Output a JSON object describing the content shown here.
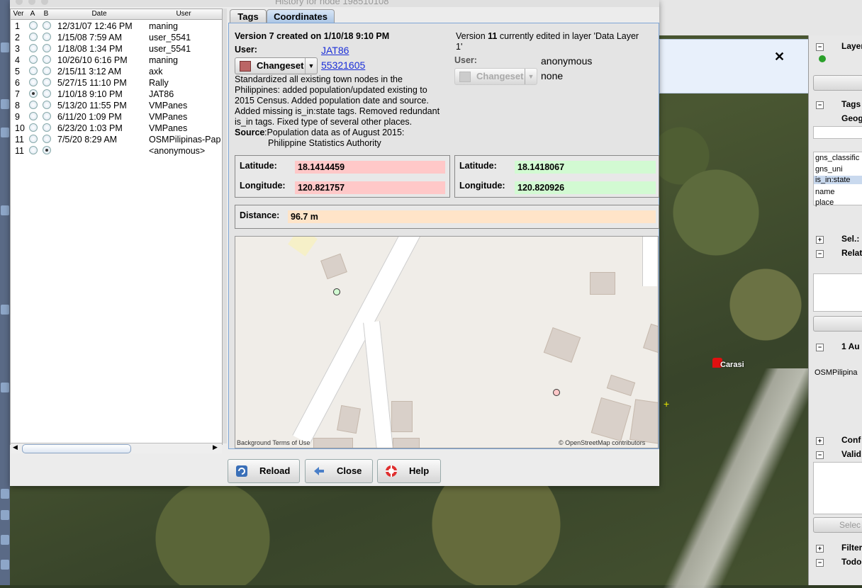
{
  "dialog": {
    "title": "History for node 198510108"
  },
  "versions_table": {
    "columns": [
      "Ver",
      "A",
      "B",
      "Date",
      "User"
    ],
    "rows": [
      {
        "ver": "1",
        "a": false,
        "b": false,
        "date": "12/31/07 12:46 PM",
        "user": "maning"
      },
      {
        "ver": "2",
        "a": false,
        "b": false,
        "date": "1/15/08 7:59 AM",
        "user": "user_5541"
      },
      {
        "ver": "3",
        "a": false,
        "b": false,
        "date": "1/18/08 1:34 PM",
        "user": "user_5541"
      },
      {
        "ver": "4",
        "a": false,
        "b": false,
        "date": "10/26/10 6:16 PM",
        "user": "maning"
      },
      {
        "ver": "5",
        "a": false,
        "b": false,
        "date": "2/15/11 3:12 AM",
        "user": "axk"
      },
      {
        "ver": "6",
        "a": false,
        "b": false,
        "date": "5/27/15 11:10 PM",
        "user": "Rally"
      },
      {
        "ver": "7",
        "a": true,
        "b": false,
        "date": "1/10/18 9:10 PM",
        "user": "JAT86"
      },
      {
        "ver": "8",
        "a": false,
        "b": false,
        "date": "5/13/20 11:55 PM",
        "user": "VMPanes"
      },
      {
        "ver": "9",
        "a": false,
        "b": false,
        "date": "6/11/20 1:09 PM",
        "user": "VMPanes"
      },
      {
        "ver": "10",
        "a": false,
        "b": false,
        "date": "6/23/20 1:03 PM",
        "user": "VMPanes"
      },
      {
        "ver": "11",
        "a": false,
        "b": false,
        "date": "7/5/20 8:29 AM",
        "user": "OSMPilipinas-Pap"
      },
      {
        "ver": "11",
        "a": false,
        "b": true,
        "date": "",
        "user": "<anonymous>"
      }
    ]
  },
  "tabs": [
    {
      "label": "Tags",
      "active": false
    },
    {
      "label": "Coordinates",
      "active": true
    }
  ],
  "left_version": {
    "header_prefix": "Version ",
    "number": "7",
    "header_mid": " created on ",
    "date": "1/10/18 9:10 PM",
    "user_label": "User:",
    "user": "JAT86",
    "changeset_label": "Changeset",
    "changeset_id": "55321605",
    "comment_lines": [
      "Standardized all existing town nodes in the",
      "Philippines: added population/updated existing to",
      "2015 Census. Added population date and source.",
      "Added missing is_in:state tags. Removed redundant",
      "is_in tags. Fixed type of several other places."
    ],
    "source_label": "Source",
    "source_lines": [
      ":Population data as of August 2015:",
      "Philippine Statistics Authority"
    ],
    "latitude_label": "Latitude:",
    "latitude": "18.1414459",
    "longitude_label": "Longitude:",
    "longitude": "120.821757"
  },
  "right_version": {
    "header_prefix": "Version ",
    "number": "11",
    "header_line1_rest": " currently edited in layer 'Data Layer",
    "header_line2": "1'",
    "user_label": "User:",
    "user": "anonymous",
    "changeset_label": "Changeset",
    "changeset_id": "none",
    "latitude_label": "Latitude:",
    "latitude": "18.1418067",
    "longitude_label": "Longitude:",
    "longitude": "120.820926"
  },
  "distance": {
    "label": "Distance:",
    "value": "96.7 m"
  },
  "map": {
    "attribution_left": "Background Terms of Use",
    "attribution_right": "© OpenStreetMap contributors"
  },
  "buttons": {
    "reload": "Reload",
    "close": "Close",
    "help": "Help"
  },
  "right_panel": {
    "layers_title": "Layers",
    "tags_title": "Tags",
    "tags_object": "Geogra",
    "tag_keys": [
      "gns_classific",
      "gns_uni",
      "is_in:state",
      "name",
      "place"
    ],
    "selection_title": "Sel.:",
    "relations_title": "Relat",
    "authors_title": "1 Au",
    "author_item": "OSMPilipina",
    "conflicts_title": "Conf",
    "validation_title": "Valid",
    "select_button": "Selec",
    "filter_title": "Filter",
    "todo_title": "Todo"
  },
  "map_label": "Carasi",
  "colors": {
    "old_value_bg": "#ffc8c8",
    "new_value_bg": "#d2fad2",
    "distance_bg": "#ffe4c8",
    "active_tab": "#a9c4e4",
    "link": "#1a2ed8"
  }
}
